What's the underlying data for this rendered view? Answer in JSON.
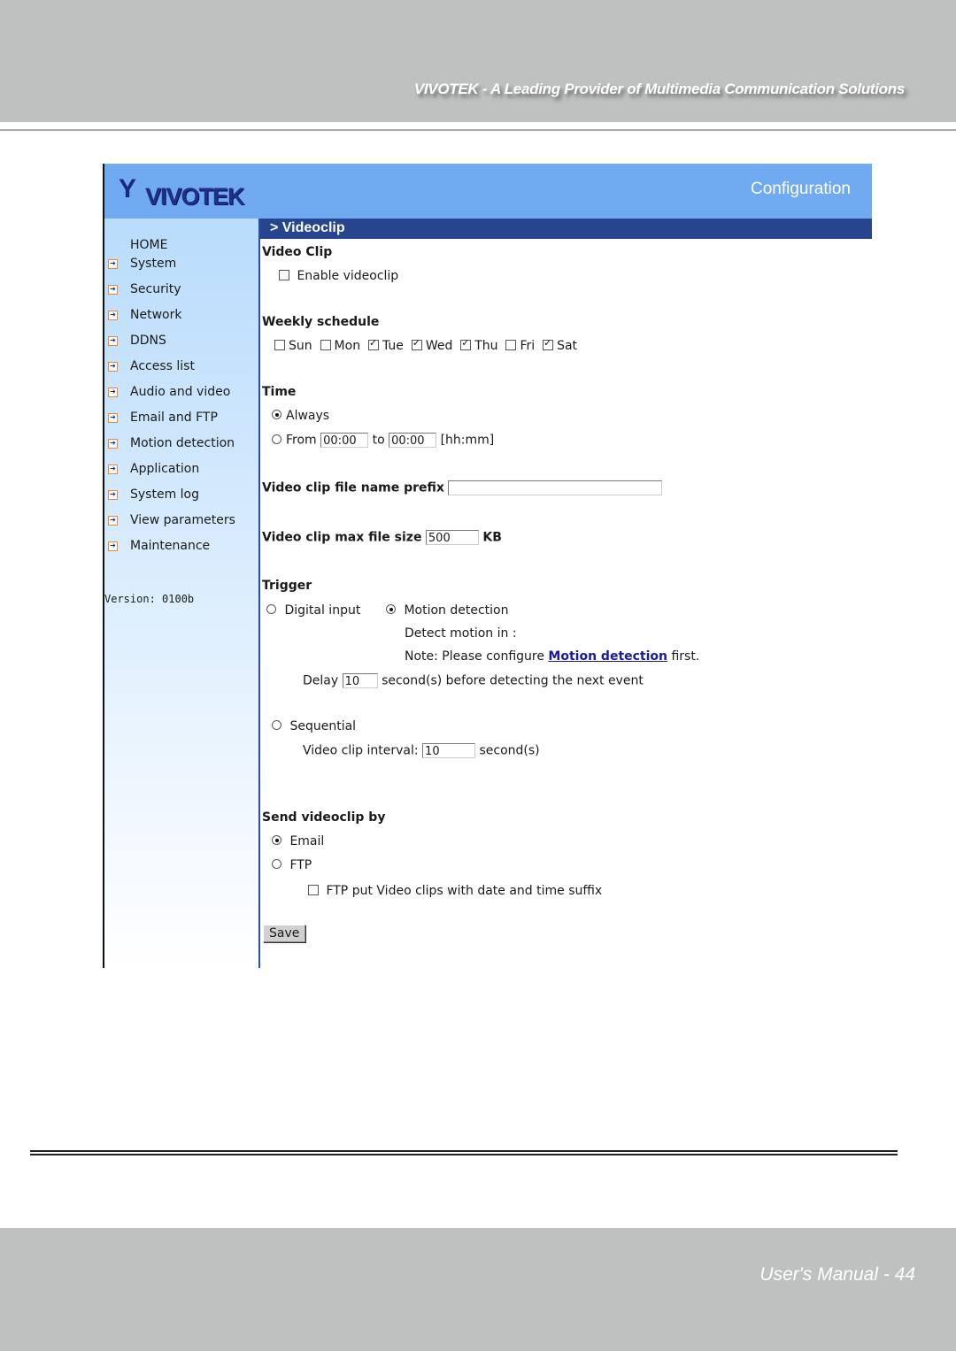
{
  "page": {
    "tagline": "VIVOTEK - A Leading Provider of Multimedia Communication Solutions",
    "footer_label": "User's Manual - 44"
  },
  "app": {
    "logo_text": "VIVOTEK",
    "header_title": "Configuration",
    "section_title": "> Videoclip"
  },
  "sidebar": {
    "home": "HOME",
    "items": [
      {
        "label": "System"
      },
      {
        "label": "Security"
      },
      {
        "label": "Network"
      },
      {
        "label": "DDNS"
      },
      {
        "label": "Access list"
      },
      {
        "label": "Audio and video"
      },
      {
        "label": "Email and FTP"
      },
      {
        "label": "Motion detection"
      },
      {
        "label": "Application"
      },
      {
        "label": "System log"
      },
      {
        "label": "View parameters"
      },
      {
        "label": "Maintenance"
      }
    ],
    "version": "Version: 0100b"
  },
  "video_clip": {
    "heading": "Video Clip",
    "enable_label": "Enable videoclip",
    "enable_checked": false
  },
  "weekly": {
    "heading": "Weekly schedule",
    "days": [
      {
        "label": "Sun",
        "checked": false
      },
      {
        "label": "Mon",
        "checked": false
      },
      {
        "label": "Tue",
        "checked": true
      },
      {
        "label": "Wed",
        "checked": true
      },
      {
        "label": "Thu",
        "checked": true
      },
      {
        "label": "Fri",
        "checked": false
      },
      {
        "label": "Sat",
        "checked": true
      }
    ]
  },
  "time": {
    "heading": "Time",
    "always_label": "Always",
    "always_selected": true,
    "from_label": "From",
    "from_value": "00:00",
    "to_label": "to",
    "to_value": "00:00",
    "format_hint": "[hh:mm]"
  },
  "prefix": {
    "label": "Video clip file name prefix",
    "value": ""
  },
  "max_size": {
    "label": "Video clip max file size",
    "value": "500",
    "unit": "KB"
  },
  "trigger": {
    "heading": "Trigger",
    "digital_input_label": "Digital input",
    "motion_label": "Motion detection",
    "motion_selected": true,
    "detect_in_label": "Detect motion in :",
    "note_prefix": "Note: Please configure",
    "note_link": "Motion detection",
    "note_suffix": "first.",
    "delay_label": "Delay",
    "delay_value": "10",
    "delay_suffix": "second(s) before detecting the next event",
    "sequential_label": "Sequential",
    "interval_label": "Video clip interval:",
    "interval_value": "10",
    "interval_suffix": "second(s)"
  },
  "send": {
    "heading": "Send videoclip by",
    "email_label": "Email",
    "email_selected": true,
    "ftp_label": "FTP",
    "ftp_suffix_label": "FTP put Video clips with date and time suffix",
    "ftp_suffix_checked": false
  },
  "save_label": "Save"
}
